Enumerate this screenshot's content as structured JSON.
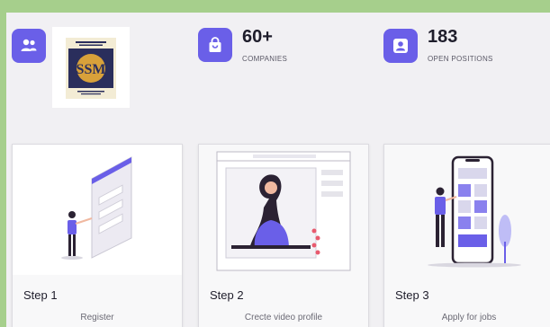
{
  "stats": [
    {
      "icon": "users-icon",
      "value": "",
      "label": ""
    },
    {
      "icon": "shopping-bag-icon",
      "value": "60+",
      "label": "COMPANIES"
    },
    {
      "icon": "user-badge-icon",
      "value": "183",
      "label": "OPEN POSITIONS"
    }
  ],
  "logo": {
    "text": "SSM"
  },
  "steps": [
    {
      "title": "Step 1",
      "description": "Register"
    },
    {
      "title": "Step 2",
      "description": "Crecte video profile"
    },
    {
      "title": "Step 3",
      "description": "Apply for jobs"
    }
  ],
  "colors": {
    "accent": "#6a5fe8",
    "frame": "#a6cf8c",
    "background": "#f1f0f3"
  }
}
